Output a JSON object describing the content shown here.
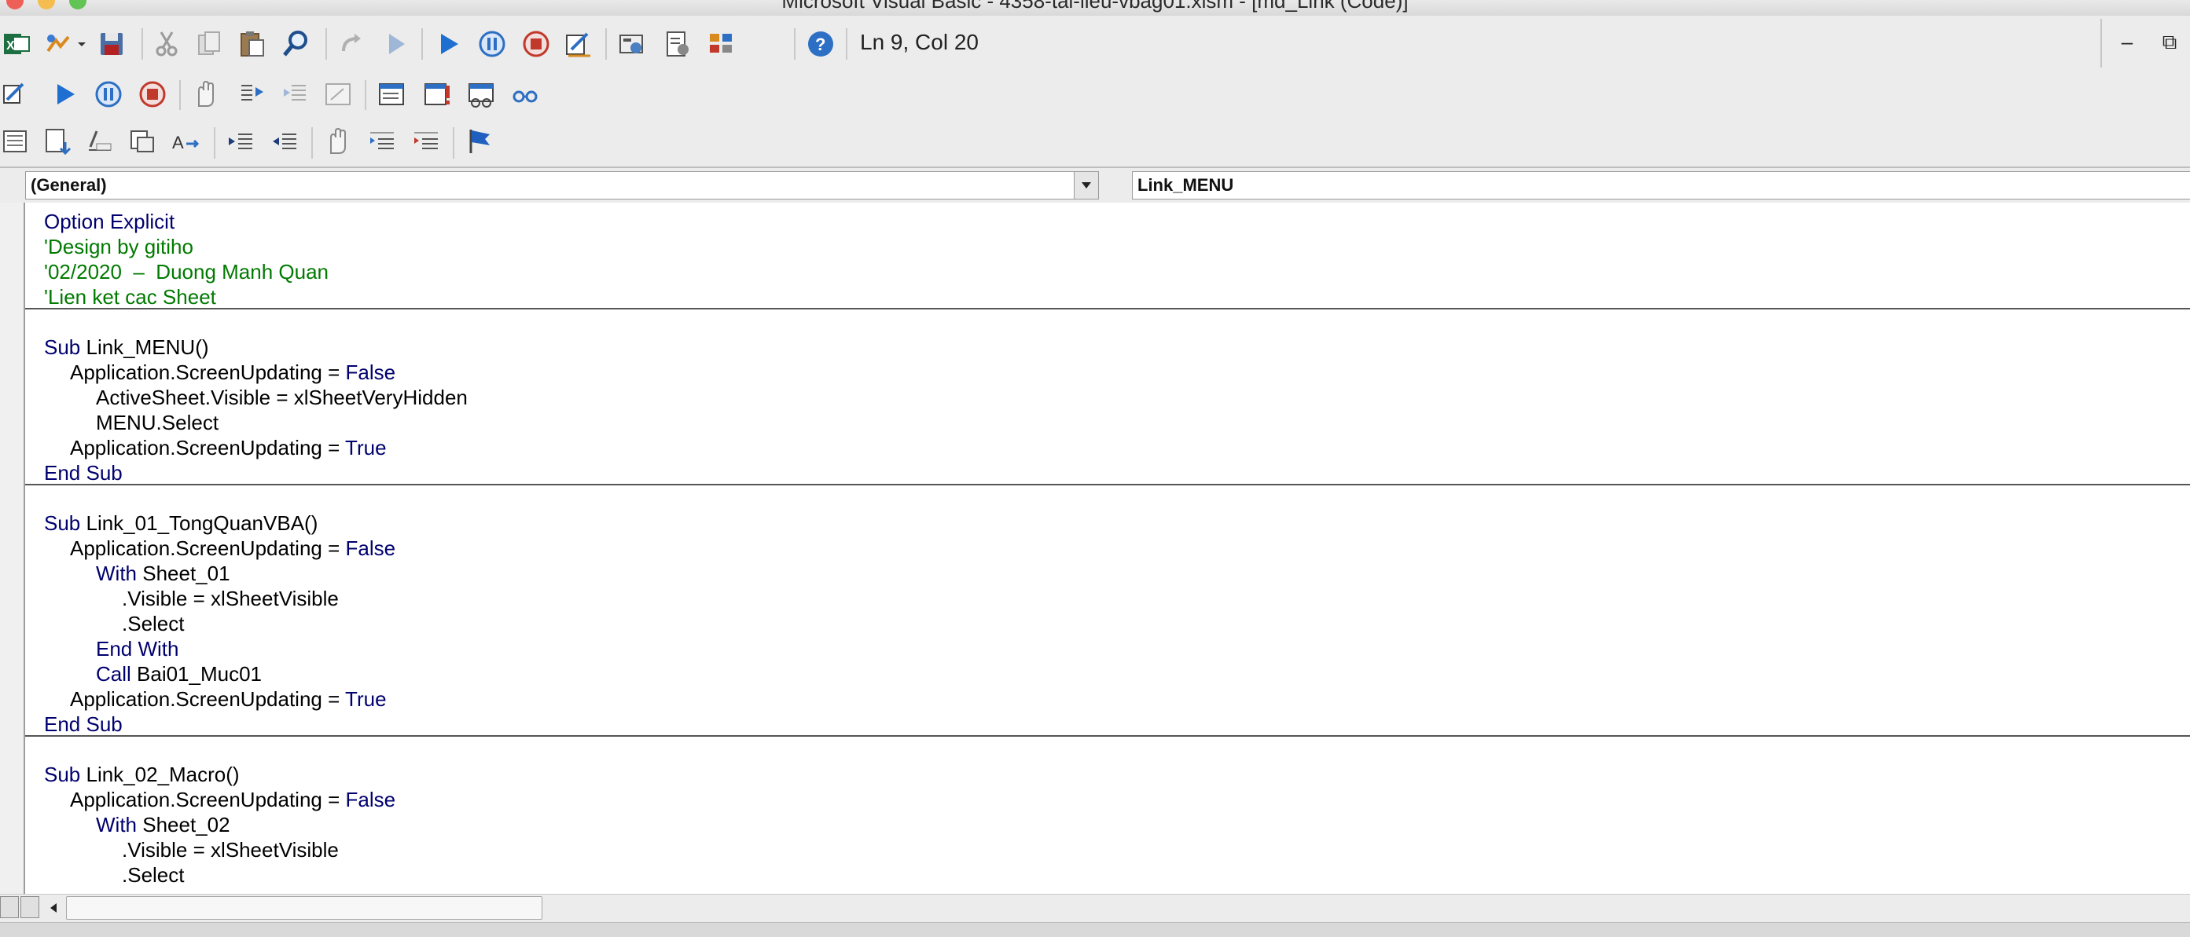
{
  "window": {
    "title": "Microsoft Visual Basic - 4358-tai-lieu-vbag01.xlsm - [md_Link (Code)]"
  },
  "toolbar": {
    "position_text": "Ln 9, Col 20",
    "minimize_label": "–",
    "restore_label": "⧉"
  },
  "combos": {
    "object_value": "(General)",
    "procedure_value": "Link_MENU"
  },
  "code": {
    "lines": [
      {
        "indent": 0,
        "parts": [
          {
            "t": "Option Explicit",
            "c": "kw"
          }
        ]
      },
      {
        "indent": 0,
        "parts": [
          {
            "t": "'Design by gitiho",
            "c": "cm"
          }
        ]
      },
      {
        "indent": 0,
        "parts": [
          {
            "t": "'02/2020  –  Duong Manh Quan",
            "c": "cm"
          }
        ]
      },
      {
        "indent": 0,
        "parts": [
          {
            "t": "'Lien ket cac Sheet",
            "c": "cm"
          }
        ]
      },
      {
        "sep": true
      },
      {
        "indent": 0,
        "parts": []
      },
      {
        "indent": 0,
        "parts": [
          {
            "t": "Sub",
            "c": "kw"
          },
          {
            "t": " Link_MENU()",
            "c": ""
          }
        ]
      },
      {
        "indent": 1,
        "parts": [
          {
            "t": "Application.ScreenUpdating = ",
            "c": ""
          },
          {
            "t": "False",
            "c": "kw"
          }
        ]
      },
      {
        "indent": 2,
        "parts": [
          {
            "t": "ActiveSheet.Visible = xlSheetVeryHidden",
            "c": ""
          }
        ]
      },
      {
        "indent": 2,
        "parts": [
          {
            "t": "MENU.Select",
            "c": ""
          }
        ]
      },
      {
        "indent": 1,
        "parts": [
          {
            "t": "Application.ScreenUpdating = ",
            "c": ""
          },
          {
            "t": "True",
            "c": "kw"
          }
        ]
      },
      {
        "indent": 0,
        "parts": [
          {
            "t": "End Sub",
            "c": "kw"
          }
        ]
      },
      {
        "sep": true
      },
      {
        "indent": 0,
        "parts": []
      },
      {
        "indent": 0,
        "parts": [
          {
            "t": "Sub",
            "c": "kw"
          },
          {
            "t": " Link_01_TongQuanVBA()",
            "c": ""
          }
        ]
      },
      {
        "indent": 1,
        "parts": [
          {
            "t": "Application.ScreenUpdating = ",
            "c": ""
          },
          {
            "t": "False",
            "c": "kw"
          }
        ]
      },
      {
        "indent": 2,
        "parts": [
          {
            "t": "With",
            "c": "kw"
          },
          {
            "t": " Sheet_01",
            "c": ""
          }
        ]
      },
      {
        "indent": 3,
        "parts": [
          {
            "t": ".Visible = xlSheetVisible",
            "c": ""
          }
        ]
      },
      {
        "indent": 3,
        "parts": [
          {
            "t": ".Select",
            "c": ""
          }
        ]
      },
      {
        "indent": 2,
        "parts": [
          {
            "t": "End With",
            "c": "kw"
          }
        ]
      },
      {
        "indent": 2,
        "parts": [
          {
            "t": "Call",
            "c": "kw"
          },
          {
            "t": " Bai01_Muc01",
            "c": ""
          }
        ]
      },
      {
        "indent": 1,
        "parts": [
          {
            "t": "Application.ScreenUpdating = ",
            "c": ""
          },
          {
            "t": "True",
            "c": "kw"
          }
        ]
      },
      {
        "indent": 0,
        "parts": [
          {
            "t": "End Sub",
            "c": "kw"
          }
        ]
      },
      {
        "sep": true
      },
      {
        "indent": 0,
        "parts": []
      },
      {
        "indent": 0,
        "parts": [
          {
            "t": "Sub",
            "c": "kw"
          },
          {
            "t": " Link_02_Macro()",
            "c": ""
          }
        ]
      },
      {
        "indent": 1,
        "parts": [
          {
            "t": "Application.ScreenUpdating = ",
            "c": ""
          },
          {
            "t": "False",
            "c": "kw"
          }
        ]
      },
      {
        "indent": 2,
        "parts": [
          {
            "t": "With",
            "c": "kw"
          },
          {
            "t": " Sheet_02",
            "c": ""
          }
        ]
      },
      {
        "indent": 3,
        "parts": [
          {
            "t": ".Visible = xlSheetVisible",
            "c": ""
          }
        ]
      },
      {
        "indent": 3,
        "parts": [
          {
            "t": ".Select",
            "c": ""
          }
        ]
      }
    ]
  },
  "colors": {
    "keyword": "#00006e",
    "comment": "#007a00",
    "run_blue": "#1f6fd1",
    "stop_red": "#c0392b"
  }
}
